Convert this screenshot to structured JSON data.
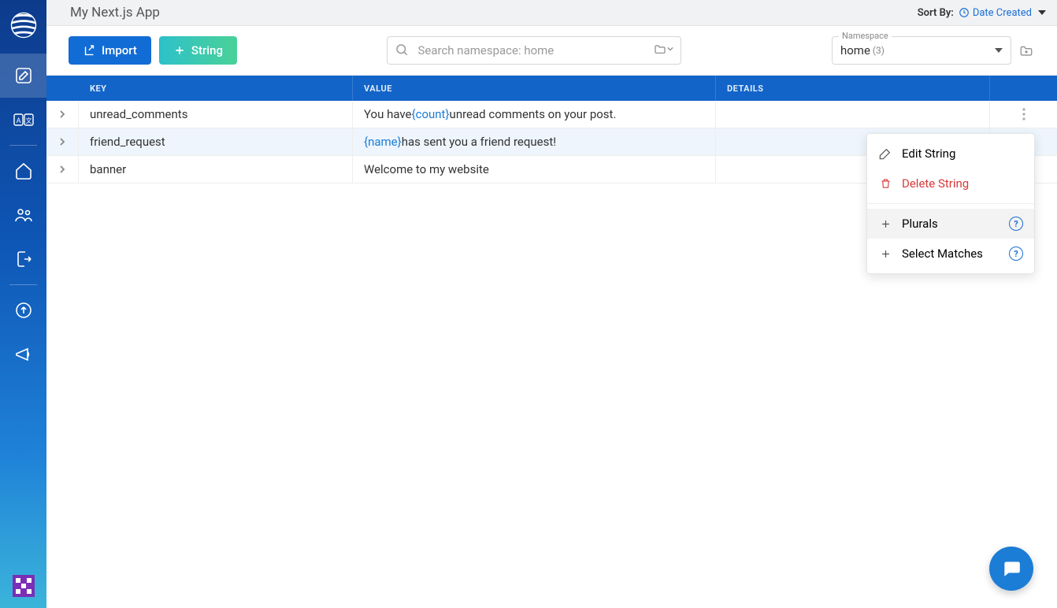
{
  "app": {
    "title": "My Next.js App"
  },
  "sort": {
    "label": "Sort By:",
    "value": "Date Created"
  },
  "toolbar": {
    "import_label": "Import",
    "string_label": "String",
    "search_placeholder": "Search namespace: home"
  },
  "namespace": {
    "label": "Namespace",
    "value": "home",
    "count": "(3)"
  },
  "columns": {
    "key": "KEY",
    "value": "VALUE",
    "details": "DETAILS"
  },
  "rows": [
    {
      "key": "unread_comments",
      "value_pre": "You have ",
      "value_token": "{count}",
      "value_post": " unread comments on your post."
    },
    {
      "key": "friend_request",
      "value_pre": "",
      "value_token": "{name}",
      "value_post": " has sent you a friend request!"
    },
    {
      "key": "banner",
      "value_pre": "Welcome to my website",
      "value_token": "",
      "value_post": ""
    }
  ],
  "menu": {
    "edit": "Edit String",
    "delete": "Delete String",
    "plurals": "Plurals",
    "select_matches": "Select Matches"
  }
}
